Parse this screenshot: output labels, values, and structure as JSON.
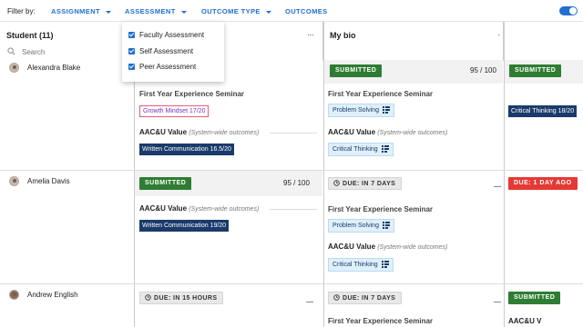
{
  "filter": {
    "label": "Filter by:",
    "buttons": [
      "ASSIGNMENT",
      "ASSESSMENT",
      "OUTCOME TYPE",
      "OUTCOMES"
    ],
    "toggle_on": true
  },
  "dropdown": {
    "items": [
      {
        "label": "Faculty Assessment",
        "checked": true
      },
      {
        "label": "Self Assessment",
        "checked": true
      },
      {
        "label": "Peer Assessment",
        "checked": true
      }
    ]
  },
  "columns": {
    "student_header": "Student (11)",
    "search_placeholder": "Search",
    "col2_more": "···",
    "col3_title": "My bio",
    "col3_more": "·"
  },
  "students": [
    {
      "name": "Alexandra Blake",
      "col2": {
        "course": "First Year Experience Seminar",
        "tag_purple": "Growth Mindset 17/20",
        "aacu_label": "AAC&U Value",
        "aacu_note": "(System-wide outcomes)",
        "tag_navy": "Written Communication 16.5/20"
      },
      "col3": {
        "badge": "SUBMITTED",
        "score": "95 / 100",
        "course": "First Year Experience Seminar",
        "tag1": "Problem Solving",
        "aacu_label": "AAC&U Value",
        "aacu_note": "(System-wide outcomes)",
        "tag2": "Critical Thinking"
      },
      "col4": {
        "badge": "SUBMITTED",
        "tag": "Critical Thinking 18/20"
      }
    },
    {
      "name": "Amelia Davis",
      "col2": {
        "badge": "SUBMITTED",
        "score": "95 / 100",
        "aacu_label": "AAC&U Value",
        "aacu_note": "(System-wide outcomes)",
        "tag_navy": "Written Communication 19/20"
      },
      "col3": {
        "badge": "DUE: IN 7 DAYS",
        "course": "First Year Experience Seminar",
        "tag1": "Problem Solving",
        "aacu_label": "AAC&U Value",
        "aacu_note": "(System-wide outcomes)",
        "tag2": "Critical Thinking"
      },
      "col4": {
        "badge": "DUE: 1 DAY AGO"
      }
    },
    {
      "name": "Andrew English",
      "col2": {
        "badge": "DUE: IN 15 HOURS"
      },
      "col3": {
        "badge": "DUE: IN 7 DAYS",
        "course": "First Year Experience Seminar"
      },
      "col4": {
        "badge": "SUBMITTED",
        "aacu_label": "AAC&U V"
      }
    }
  ]
}
